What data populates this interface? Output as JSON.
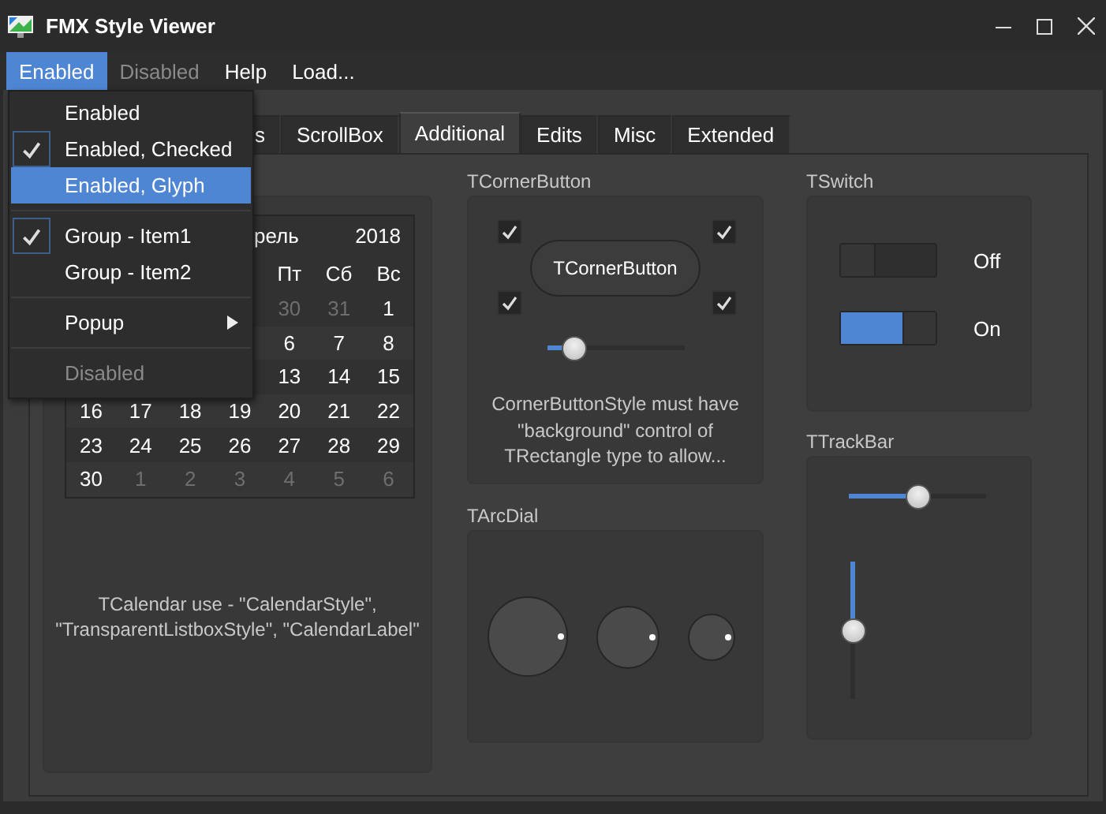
{
  "window": {
    "title": "FMX Style Viewer"
  },
  "menu_bar": [
    {
      "label": "Enabled",
      "selected": true,
      "disabled": false
    },
    {
      "label": "Disabled",
      "selected": false,
      "disabled": true
    },
    {
      "label": "Help",
      "selected": false,
      "disabled": false
    },
    {
      "label": "Load...",
      "selected": false,
      "disabled": false
    }
  ],
  "dropdown": {
    "items": [
      {
        "kind": "item",
        "label": "Enabled",
        "checked": false,
        "selected": false,
        "disabled": false
      },
      {
        "kind": "item",
        "label": "Enabled, Checked",
        "checked": true,
        "selected": false,
        "disabled": false
      },
      {
        "kind": "item",
        "label": "Enabled, Glyph",
        "checked": false,
        "selected": true,
        "disabled": false
      },
      {
        "kind": "separator"
      },
      {
        "kind": "item",
        "label": "Group - Item1",
        "checked": true,
        "selected": false,
        "disabled": false
      },
      {
        "kind": "item",
        "label": "Group - Item2",
        "checked": false,
        "selected": false,
        "disabled": false
      },
      {
        "kind": "separator"
      },
      {
        "kind": "submenu",
        "label": "Popup",
        "checked": false,
        "selected": false,
        "disabled": false
      },
      {
        "kind": "separator"
      },
      {
        "kind": "item",
        "label": "Disabled",
        "checked": false,
        "selected": false,
        "disabled": true
      }
    ]
  },
  "tabs": [
    {
      "label": "s",
      "selected": false
    },
    {
      "label": "ScrollBox",
      "selected": false
    },
    {
      "label": "Additional",
      "selected": true
    },
    {
      "label": "Edits",
      "selected": false
    },
    {
      "label": "Misc",
      "selected": false
    },
    {
      "label": "Extended",
      "selected": false
    }
  ],
  "calendar_group": {
    "calendar": {
      "month": "рель",
      "year": "2018",
      "weekdays": [
        "Пт",
        "Сб",
        "Вс"
      ],
      "weeks": [
        [
          {
            "day": "30",
            "other_month": true
          },
          {
            "day": "31",
            "other_month": true
          },
          {
            "day": "1",
            "other_month": false
          }
        ],
        [
          {
            "day": "6",
            "other_month": false
          },
          {
            "day": "7",
            "other_month": false
          },
          {
            "day": "8",
            "other_month": false
          }
        ],
        [
          {
            "day": "13",
            "other_month": false
          },
          {
            "day": "14",
            "other_month": false
          },
          {
            "day": "15",
            "other_month": false
          }
        ],
        [
          {
            "day": "16",
            "other_month": false
          },
          {
            "day": "17",
            "other_month": false
          },
          {
            "day": "18",
            "other_month": false
          },
          {
            "day": "19",
            "other_month": false
          },
          {
            "day": "20",
            "other_month": false
          },
          {
            "day": "21",
            "other_month": false
          },
          {
            "day": "22",
            "other_month": false
          }
        ],
        [
          {
            "day": "23",
            "other_month": false
          },
          {
            "day": "24",
            "other_month": false
          },
          {
            "day": "25",
            "other_month": false
          },
          {
            "day": "26",
            "other_month": false
          },
          {
            "day": "27",
            "other_month": false
          },
          {
            "day": "28",
            "other_month": false
          },
          {
            "day": "29",
            "other_month": false
          }
        ],
        [
          {
            "day": "30",
            "other_month": false
          },
          {
            "day": "1",
            "other_month": true
          },
          {
            "day": "2",
            "other_month": true
          },
          {
            "day": "3",
            "other_month": true
          },
          {
            "day": "4",
            "other_month": true
          },
          {
            "day": "5",
            "other_month": true
          },
          {
            "day": "6",
            "other_month": true
          }
        ]
      ]
    },
    "note": "TCalendar use - \"CalendarStyle\", \"TransparentListboxStyle\", \"CalendarLabel\""
  },
  "corner_button_group": {
    "title": "TCornerButton",
    "corners": [
      {
        "checked": true
      },
      {
        "checked": true
      },
      {
        "checked": true
      },
      {
        "checked": true
      }
    ],
    "button": "TCornerButton",
    "slider": {
      "level": 0.2
    },
    "note": "CornerButtonStyle must have \"background\" control of TRectangle type to allow..."
  },
  "arc_dial_group": {
    "title": "TArcDial"
  },
  "switch_group": {
    "title": "TSwitch",
    "switches": [
      {
        "on": false,
        "label": "Off"
      },
      {
        "on": true,
        "label": "On"
      }
    ]
  },
  "trackbar_group": {
    "title": "TTrackBar",
    "trackbars": [
      {
        "kind": "horizontal",
        "level": 0.5
      },
      {
        "kind": "vertical",
        "level": 0.5
      }
    ]
  }
}
